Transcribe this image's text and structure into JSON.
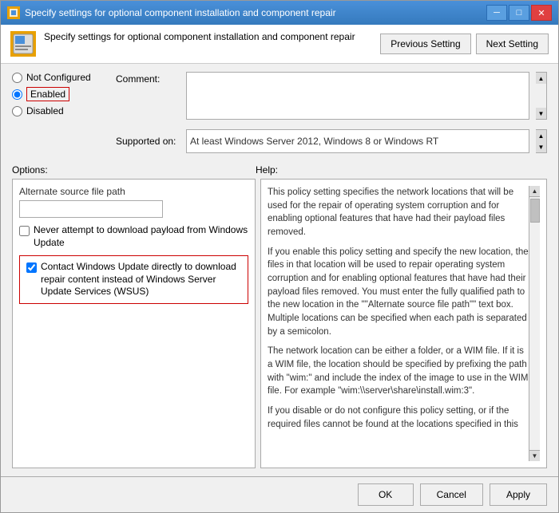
{
  "titlebar": {
    "title": "Specify settings for optional component installation and component repair",
    "icon": "⚙",
    "min_label": "─",
    "max_label": "□",
    "close_label": "✕"
  },
  "header": {
    "icon": "⚙",
    "description": "Specify settings for optional component installation and component repair",
    "prev_button": "Previous Setting",
    "next_button": "Next Setting"
  },
  "radio": {
    "not_configured_label": "Not Configured",
    "enabled_label": "Enabled",
    "disabled_label": "Disabled"
  },
  "comment": {
    "label": "Comment:"
  },
  "supported": {
    "label": "Supported on:",
    "value": "At least Windows Server 2012, Windows 8 or Windows RT"
  },
  "options": {
    "label": "Options:",
    "alt_source_label": "Alternate source file path",
    "never_attempt_label": "Never attempt to download payload from Windows Update",
    "contact_label": "Contact Windows Update directly to download repair content instead of Windows Server Update Services (WSUS)"
  },
  "help": {
    "label": "Help:",
    "paragraphs": [
      "This policy setting specifies the network locations that will be used for the repair of operating system corruption and for enabling optional features that have had their payload files removed.",
      "If you enable this policy setting and specify the new location, the files in that location will be used to repair operating system corruption and for enabling optional features that have had their payload files removed. You must enter the fully qualified path to the new location in the \"\"Alternate source file path\"\" text box. Multiple locations can be specified when each path is separated by a semicolon.",
      "The network location can be either a folder, or a WIM file. If it is a WIM file, the location should be specified by prefixing the path with \"wim:\" and include the index of the image to use in the WIM file. For example \"wim:\\\\server\\share\\install.wim:3\".",
      "If you disable or do not configure this policy setting, or if the required files cannot be found at the locations specified in this"
    ]
  },
  "buttons": {
    "ok": "OK",
    "cancel": "Cancel",
    "apply": "Apply"
  }
}
